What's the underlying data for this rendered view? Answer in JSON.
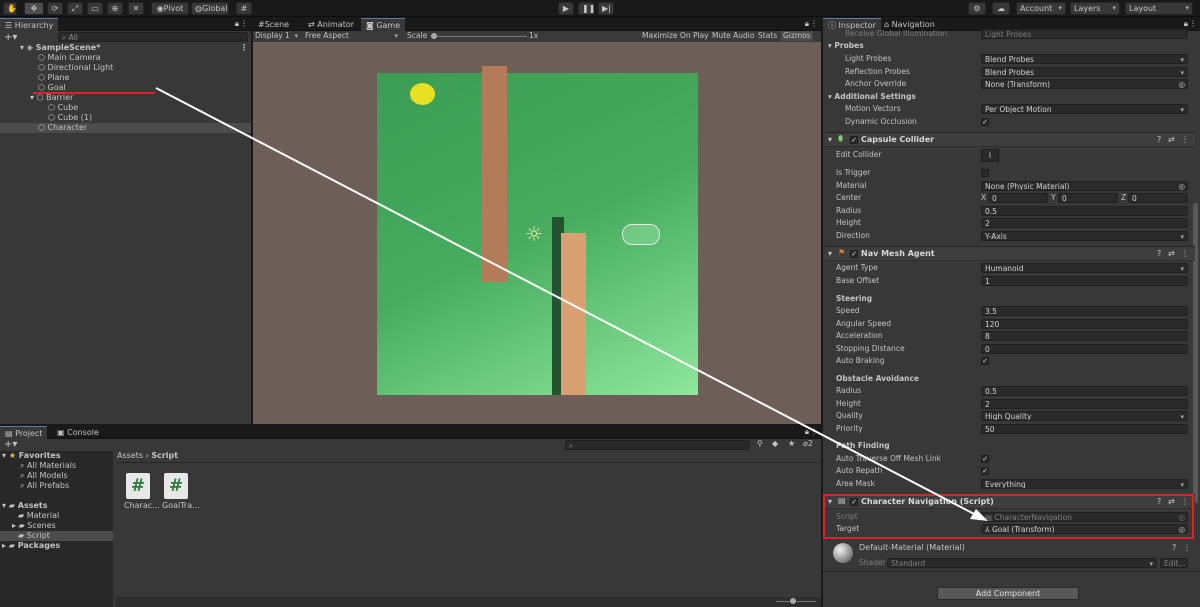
{
  "toolbar": {
    "pivot": "Pivot",
    "global": "Global",
    "account": "Account",
    "layers": "Layers",
    "layout": "Layout"
  },
  "hierarchy": {
    "tab": "Hierarchy",
    "search_placeholder": "All",
    "scene": "SampleScene*",
    "items": [
      "Main Camera",
      "Directional Light",
      "Plane",
      "Goal",
      "Barrier",
      "Cube",
      "Cube (1)",
      "Character"
    ]
  },
  "game": {
    "tabs": [
      "Scene",
      "Animator",
      "Game"
    ],
    "display": "Display 1",
    "aspect": "Free Aspect",
    "scale_label": "Scale",
    "scale_value": "1x",
    "toggles": [
      "Maximize On Play",
      "Mute Audio",
      "Stats",
      "Gizmos"
    ]
  },
  "project": {
    "tabs": [
      "Project",
      "Console"
    ],
    "favorites": "Favorites",
    "fav_items": [
      "All Materials",
      "All Models",
      "All Prefabs"
    ],
    "assets": "Assets",
    "asset_items": [
      "Material",
      "Scenes",
      "Script"
    ],
    "packages": "Packages",
    "breadcrumb": [
      "Assets",
      "Script"
    ],
    "files": [
      "Charac...",
      "GoalTra..."
    ],
    "count": "2"
  },
  "inspector": {
    "tabs": [
      "Inspector",
      "Navigation"
    ],
    "top_cut": "Receive Global Illumination",
    "top_cut_value": "Light Probes",
    "probes": {
      "header": "Probes",
      "light_probes": "Light Probes",
      "light_probes_v": "Blend Probes",
      "reflection_probes": "Reflection Probes",
      "reflection_probes_v": "Blend Probes",
      "anchor_override": "Anchor Override",
      "anchor_override_v": "None (Transform)"
    },
    "additional": {
      "header": "Additional Settings",
      "motion_vectors": "Motion Vectors",
      "motion_vectors_v": "Per Object Motion",
      "dynamic_occlusion": "Dynamic Occlusion"
    },
    "capsule": {
      "title": "Capsule Collider",
      "edit": "Edit Collider",
      "trigger": "Is Trigger",
      "material": "Material",
      "material_v": "None (Physic Material)",
      "center": "Center",
      "cx": "0",
      "cy": "0",
      "cz": "0",
      "radius": "Radius",
      "radius_v": "0.5",
      "height": "Height",
      "height_v": "2",
      "direction": "Direction",
      "direction_v": "Y-Axis"
    },
    "navmesh": {
      "title": "Nav Mesh Agent",
      "agent_type": "Agent Type",
      "agent_type_v": "Humanoid",
      "base_offset": "Base Offset",
      "base_offset_v": "1",
      "steering": "Steering",
      "speed": "Speed",
      "speed_v": "3.5",
      "ang": "Angular Speed",
      "ang_v": "120",
      "acc": "Acceleration",
      "acc_v": "8",
      "stop": "Stopping Distance",
      "stop_v": "0",
      "brake": "Auto Braking",
      "obstacle": "Obstacle Avoidance",
      "oradius": "Radius",
      "oradius_v": "0.5",
      "oheight": "Height",
      "oheight_v": "2",
      "quality": "Quality",
      "quality_v": "High Quality",
      "priority": "Priority",
      "priority_v": "50",
      "pathfinding": "Path Finding",
      "traverse": "Auto Traverse Off Mesh Link",
      "repath": "Auto Repath",
      "area": "Area Mask",
      "area_v": "Everything"
    },
    "charnav": {
      "title": "Character Navigation (Script)",
      "script": "Script",
      "script_v": "CharacterNavigation",
      "target": "Target",
      "target_v": "Goal (Transform)"
    },
    "material": {
      "title": "Default-Material (Material)",
      "shader": "Shader",
      "shader_v": "Standard",
      "edit": "Edit..."
    },
    "add_component": "Add Component"
  },
  "colors": {
    "highlight": "#e0202a",
    "accent": "#5a7bb0"
  }
}
